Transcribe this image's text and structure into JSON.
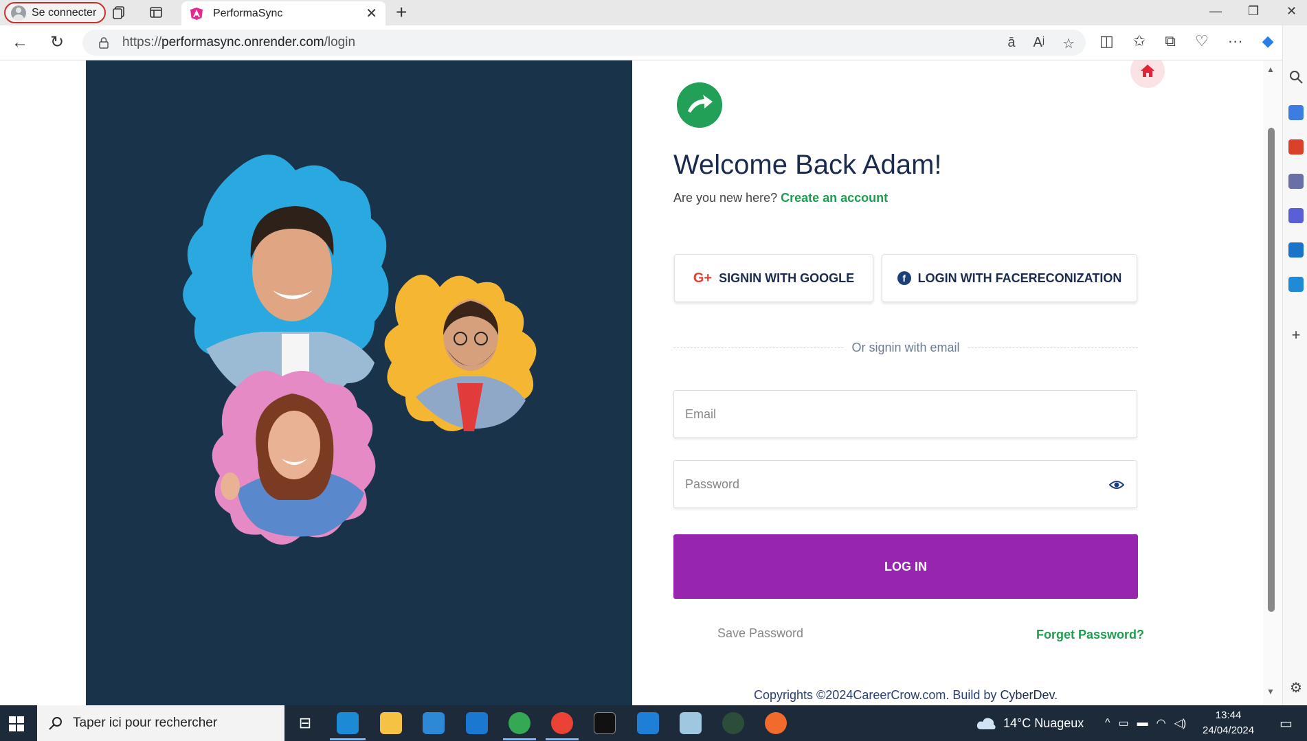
{
  "browser": {
    "profile_label": "Se connecter",
    "tab_title": "PerformaSync",
    "url_prefix": "https://",
    "url_host": "performasync.onrender.com",
    "url_path": "/login"
  },
  "page": {
    "welcome_title": "Welcome Back Adam!",
    "new_here_text": "Are you new here?",
    "create_account_link": "Create an account",
    "google_button": "SIGNIN WITH GOOGLE",
    "face_button": "LOGIN WITH FACERECONIZATION",
    "divider_text": "Or signin with email",
    "email_placeholder": "Email",
    "password_placeholder": "Password",
    "login_button": "LOG IN",
    "save_password": "Save Password",
    "forget_password": "Forget Password?",
    "copyright_text": "Copyrights ©2024CareerCrow.com. Build by",
    "copyright_brand": "CyberDev",
    "copyright_end": "."
  },
  "taskbar": {
    "search_placeholder": "Taper ici pour rechercher",
    "weather": "14°C  Nuageux",
    "time": "13:44",
    "date": "24/04/2024"
  },
  "colors": {
    "panel": "#19344a",
    "accent_purple": "#9725b0",
    "accent_green": "#1f9d4e"
  }
}
